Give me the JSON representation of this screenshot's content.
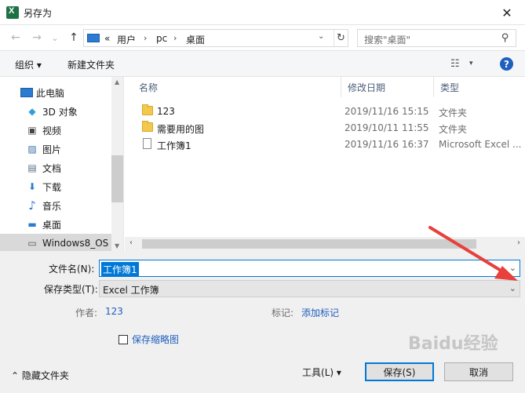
{
  "window": {
    "title": "另存为",
    "close_glyph": "✕"
  },
  "address": {
    "back_glyph": "←",
    "forward_glyph": "→",
    "recent_glyph": "⌄",
    "up_glyph": "↑",
    "crumbs": [
      "«",
      "用户",
      "pc",
      "桌面"
    ],
    "separator": "›",
    "dropdown_glyph": "⌄",
    "refresh_glyph": "↻",
    "search_placeholder": "搜索\"桌面\"",
    "search_glyph": "⚲"
  },
  "toolbar": {
    "organize_label": "组织 ▾",
    "new_folder_label": "新建文件夹",
    "view_glyph": "☷",
    "view_drop_glyph": "▾",
    "help_glyph": "?"
  },
  "nav": {
    "items": [
      {
        "label": "此电脑",
        "icon": "computer-icon"
      },
      {
        "label": "3D 对象",
        "icon": "cube-icon"
      },
      {
        "label": "视频",
        "icon": "video-icon"
      },
      {
        "label": "图片",
        "icon": "picture-icon"
      },
      {
        "label": "文档",
        "icon": "document-icon"
      },
      {
        "label": "下载",
        "icon": "download-icon"
      },
      {
        "label": "音乐",
        "icon": "music-icon"
      },
      {
        "label": "桌面",
        "icon": "desktop-icon"
      },
      {
        "label": "Windows8_OS",
        "icon": "drive-icon"
      }
    ],
    "glyphs": {
      "cube": "◆",
      "video": "▣",
      "picture": "▨",
      "document": "▤",
      "download": "⬇",
      "music": "♪",
      "desktop": "▬",
      "drive": "▭"
    }
  },
  "files": {
    "headers": {
      "name": "名称",
      "modified": "修改日期",
      "type": "类型",
      "sort_glyph": "^"
    },
    "rows": [
      {
        "name": "123",
        "modified": "2019/11/16 15:15",
        "type": "文件夹",
        "kind": "folder"
      },
      {
        "name": "需要用的图",
        "modified": "2019/10/11 11:55",
        "type": "文件夹",
        "kind": "folder"
      },
      {
        "name": "工作簿1",
        "modified": "2019/11/16 16:37",
        "type": "Microsoft Excel ...",
        "kind": "file"
      }
    ]
  },
  "scroll": {
    "up": "▲",
    "down": "▼",
    "left": "‹",
    "right": "›"
  },
  "form": {
    "filename_label": "文件名(N):",
    "filename_value": "工作簿1",
    "filetype_label": "保存类型(T):",
    "filetype_value": "Excel 工作簿",
    "author_label": "作者:",
    "author_value": "123",
    "tags_label": "标记:",
    "tags_value": "添加标记",
    "thumbnail_label": "保存缩略图",
    "drop_glyph": "⌄"
  },
  "footer": {
    "hide_folders_label": "⌃  隐藏文件夹",
    "tools_label": "工具(L)  ▾",
    "save_label": "保存(S)",
    "cancel_label": "取消"
  },
  "watermark": {
    "text": "Baidu经验"
  },
  "colors": {
    "accent": "#0078d7",
    "link": "#1f5fbf",
    "annotation_arrow": "#e8403a"
  }
}
